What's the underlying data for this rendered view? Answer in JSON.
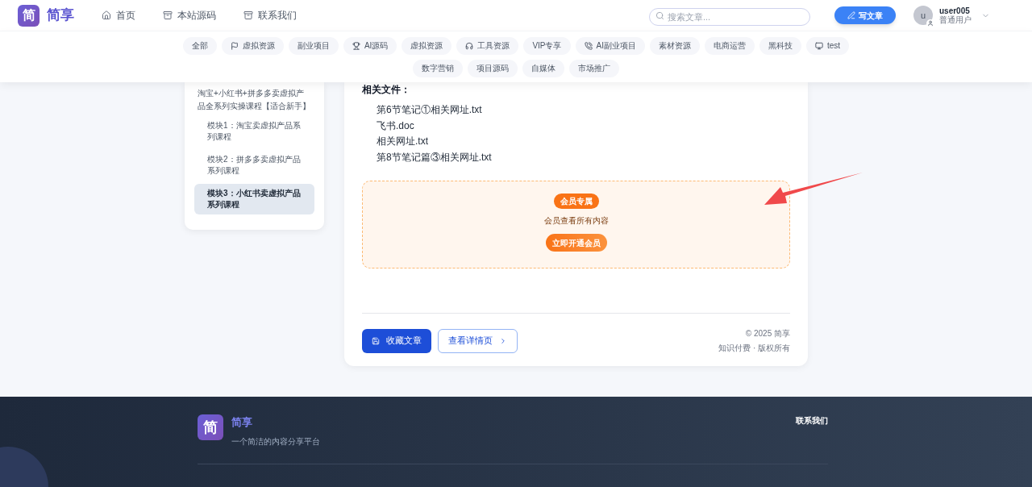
{
  "header": {
    "logo_mark": "简",
    "site_name": "简享",
    "nav": [
      {
        "label": "首页"
      },
      {
        "label": "本站源码"
      },
      {
        "label": "联系我们"
      }
    ],
    "search": {
      "placeholder": "搜索文章..."
    },
    "write_button": "写文章",
    "user": {
      "avatar_letter": "u",
      "name": "user005",
      "role": "普通用户"
    }
  },
  "categories": [
    [
      {
        "label": "全部"
      },
      {
        "label": "虚拟资源"
      },
      {
        "label": "副业项目"
      },
      {
        "label": "AI源码"
      },
      {
        "label": "虚拟资源"
      },
      {
        "label": "工具资源"
      },
      {
        "label": "VIP专享"
      },
      {
        "label": "AI副业项目"
      },
      {
        "label": "素材资源"
      },
      {
        "label": "电商运营"
      },
      {
        "label": "黑科技"
      },
      {
        "label": "test"
      }
    ],
    [
      {
        "label": "数字营销"
      },
      {
        "label": "项目源码"
      },
      {
        "label": "自媒体"
      },
      {
        "label": "市场推广"
      }
    ]
  ],
  "sidebar": {
    "title": "淘宝+小红书+拼多多卖虚拟产品全系列实操课程【适合新手】",
    "items": [
      {
        "label": "模块1：淘宝卖虚拟产品系列课程",
        "selected": false
      },
      {
        "label": "模块2：拼多多卖虚拟产品系列课程",
        "selected": false
      },
      {
        "label": "模块3：小红书卖虚拟产品系列课程",
        "selected": true
      }
    ]
  },
  "article": {
    "files_heading": "相关文件：",
    "files": [
      "第6节笔记①相关网址.txt",
      "飞书.doc",
      "相关网址.txt",
      "第8节笔记篇③相关网址.txt"
    ],
    "member_box": {
      "badge": "会员专属",
      "message": "会员查看所有内容",
      "button": "立即开通会员"
    },
    "favorite_button": "收藏文章",
    "details_button": "查看详情页",
    "copyright": "© 2025 简享",
    "rights": "知识付费 · 版权所有"
  },
  "footer": {
    "logo_mark": "简",
    "site_name": "简享",
    "tagline": "一个简洁的内容分享平台",
    "contact_heading": "联系我们"
  }
}
